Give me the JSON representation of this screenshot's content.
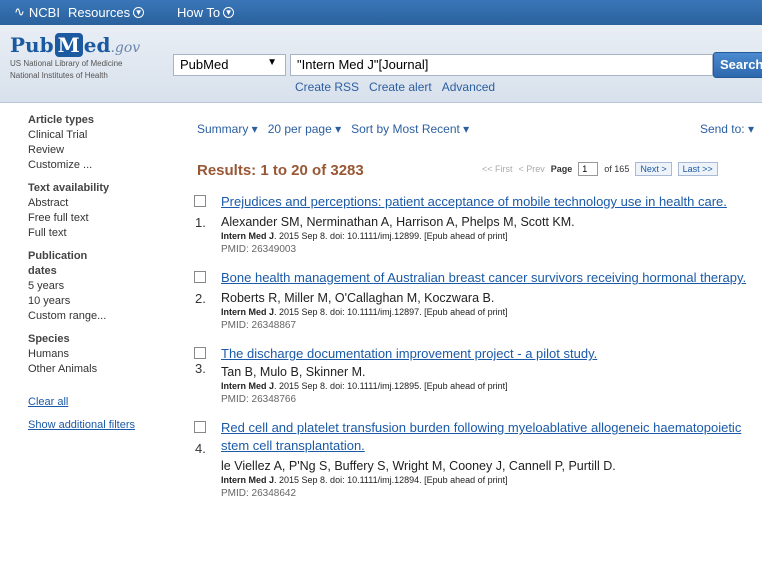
{
  "ncbi_bar": {
    "logo": "NCBI",
    "resources": "Resources",
    "howto": "How To"
  },
  "header": {
    "logo_pub": "Pub",
    "logo_m": "M",
    "logo_ed": "ed",
    "logo_gov": ".gov",
    "logo_sub1": "US National Library of Medicine",
    "logo_sub2": "National Institutes of Health",
    "db_select": "PubMed",
    "search_value": "\"Intern Med J\"[Journal]",
    "search_button": "Search",
    "links": [
      "Create RSS",
      "Create alert",
      "Advanced"
    ]
  },
  "sidebar": {
    "groups": [
      {
        "title": "Article types",
        "items": [
          "Clinical Trial",
          "Review",
          "Customize ..."
        ]
      },
      {
        "title": "Text availability",
        "items": [
          "Abstract",
          "Free full text",
          "Full text"
        ]
      },
      {
        "title": "Publication dates",
        "items": [
          "5 years",
          "10 years",
          "Custom range..."
        ]
      },
      {
        "title": "Species",
        "items": [
          "Humans",
          "Other Animals"
        ]
      }
    ],
    "clear_all": "Clear all",
    "show_filters": "Show additional filters"
  },
  "toolbar": {
    "summary": "Summary",
    "per_page": "20 per page",
    "sort": "Sort by Most Recent",
    "send_to": "Send to:"
  },
  "results_header": {
    "title": "Results: 1 to 20 of 3283",
    "first": "<< First",
    "prev": "< Prev",
    "page_label": "Page",
    "page_value": "1",
    "of_pages": "of 165",
    "next": "Next >",
    "last": "Last >>"
  },
  "results": [
    {
      "num": "1.",
      "title": "Prejudices and perceptions: patient acceptance of mobile technology use in health care.",
      "authors": "Alexander SM, Nerminathan A, Harrison A, Phelps M, Scott KM.",
      "journal": "Intern Med J",
      "cite": ". 2015 Sep 8. doi: 10.1111/imj.12899. [Epub ahead of print]",
      "pmid": "PMID: 26349003"
    },
    {
      "num": "2.",
      "title": "Bone health management of Australian breast cancer survivors receiving hormonal therapy.",
      "authors": "Roberts R, Miller M, O'Callaghan M, Koczwara B.",
      "journal": "Intern Med J",
      "cite": ". 2015 Sep 8. doi: 10.1111/imj.12897. [Epub ahead of print]",
      "pmid": "PMID: 26348867"
    },
    {
      "num": "3.",
      "title": "The discharge documentation improvement project - a pilot study.",
      "authors": "Tan B, Mulo B, Skinner M.",
      "journal": "Intern Med J",
      "cite": ". 2015 Sep 8. doi: 10.1111/imj.12895. [Epub ahead of print]",
      "pmid": "PMID: 26348766"
    },
    {
      "num": "4.",
      "title": "Red cell and platelet transfusion burden following myeloablative allogeneic haematopoietic stem cell transplantation.",
      "authors": "le Viellez A, P'Ng S, Buffery S, Wright M, Cooney J, Cannell P, Purtill D.",
      "journal": "Intern Med J",
      "cite": ". 2015 Sep 8. doi: 10.1111/imj.12894. [Epub ahead of print]",
      "pmid": "PMID: 26348642"
    }
  ]
}
